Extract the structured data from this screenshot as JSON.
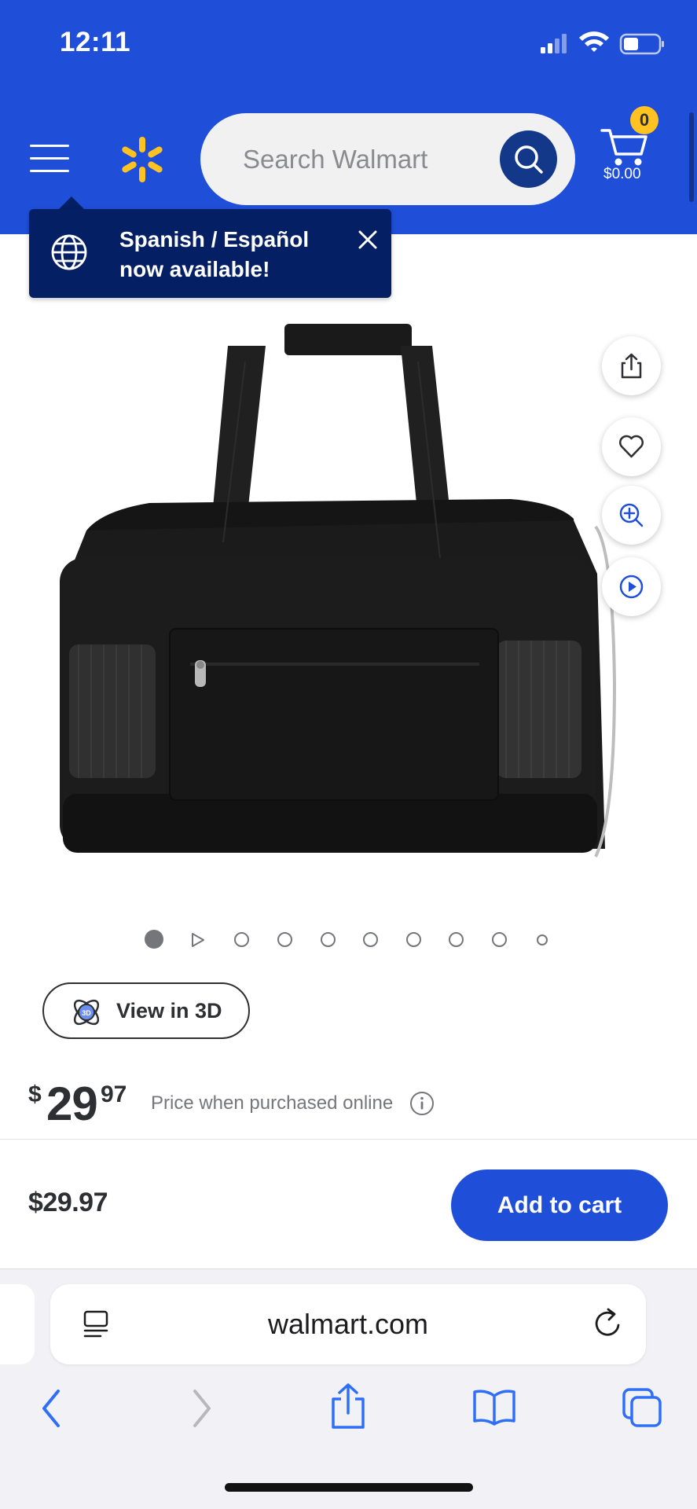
{
  "status_bar": {
    "time": "12:11"
  },
  "header": {
    "search_placeholder": "Search Walmart",
    "cart_count": "0",
    "cart_total": "$0.00"
  },
  "tooltip": {
    "line1": "Spanish / Español",
    "line2": "now available!"
  },
  "carousel": {
    "total_items": 10,
    "active_index": 0
  },
  "view3d": {
    "label": "View in 3D"
  },
  "price": {
    "symbol": "$",
    "dollars": "29",
    "cents": "97",
    "note": "Price when purchased online"
  },
  "sticky_bar": {
    "price": "$29.97",
    "add_to_cart_label": "Add to cart"
  },
  "browser": {
    "url": "walmart.com"
  },
  "colors": {
    "brand_blue": "#1f4fd9",
    "spark_yellow": "#ffc220",
    "tooltip_navy": "#041f63"
  },
  "icons": [
    "menu-icon",
    "walmart-spark-icon",
    "search-icon",
    "cart-icon",
    "globe-icon",
    "close-icon",
    "share-icon",
    "heart-icon",
    "zoom-in-icon",
    "play-icon",
    "3d-icon",
    "info-icon",
    "reader-icon",
    "reload-icon",
    "back-icon",
    "forward-icon",
    "bookmarks-icon",
    "tabs-icon"
  ]
}
